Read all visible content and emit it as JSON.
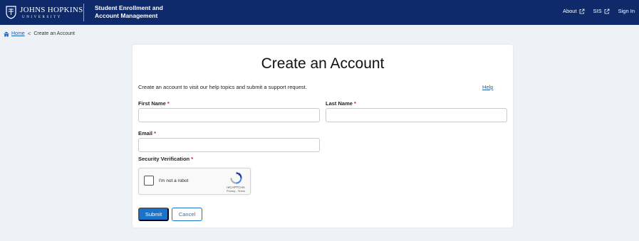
{
  "header": {
    "logo_name": "JOHNS HOPKINS",
    "logo_sub": "UNIVERSITY",
    "app_title_line1": "Student Enrollment and",
    "app_title_line2": "Account Management",
    "nav": [
      {
        "label": "About",
        "external": true
      },
      {
        "label": "SIS",
        "external": true
      },
      {
        "label": "Sign In",
        "external": false
      }
    ]
  },
  "breadcrumb": {
    "home": "Home",
    "separator": "<",
    "current": "Create an Account"
  },
  "form": {
    "title": "Create an Account",
    "intro": "Create an account to visit our help topics and submit a support request.",
    "help_link": "Help",
    "first_name_label": "First Name",
    "last_name_label": "Last Name",
    "email_label": "Email",
    "security_label": "Security Verification",
    "required_marker": "*",
    "first_name_value": "",
    "last_name_value": "",
    "email_value": "",
    "captcha": {
      "label": "I'm not a robot",
      "brand": "reCAPTCHA",
      "links": "Privacy - Terms"
    },
    "submit_label": "Submit",
    "cancel_label": "Cancel"
  },
  "colors": {
    "header_bg": "#0f2a6b",
    "primary": "#1b72c9",
    "required": "#c01d2e",
    "page_bg": "#eef1f5"
  }
}
